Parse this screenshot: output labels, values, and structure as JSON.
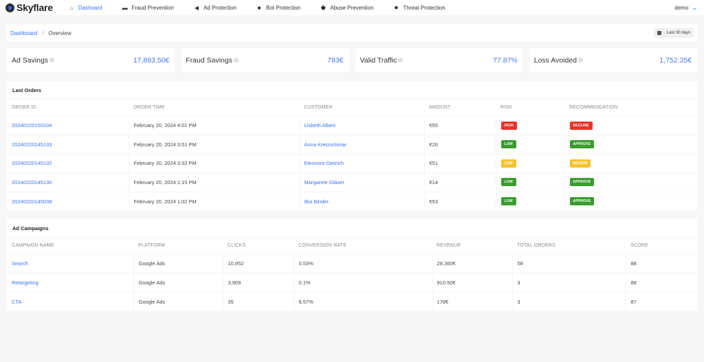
{
  "brand": {
    "name": "Skyflare"
  },
  "nav": {
    "items": [
      {
        "label": "Dashoard",
        "icon": "home-icon",
        "active": true
      },
      {
        "label": "Fraud Prevention",
        "icon": "credit-card-icon",
        "active": false
      },
      {
        "label": "Ad Protection",
        "icon": "megaphone-icon",
        "active": false
      },
      {
        "label": "Bot Protection",
        "icon": "robot-icon",
        "active": false
      },
      {
        "label": "Abuse Prevention",
        "icon": "shield-icon",
        "active": false
      },
      {
        "label": "Threat Protection",
        "icon": "gear-icon",
        "active": false
      }
    ],
    "user": "demo"
  },
  "breadcrumb": {
    "root": "Dashboard",
    "separator": "/",
    "current": "Overview"
  },
  "date_range": "Last 30 days",
  "stats": [
    {
      "label": "Ad Savings",
      "value": "17,893.50€"
    },
    {
      "label": "Fraud Savings",
      "value": "783€"
    },
    {
      "label": "Valid Traffic",
      "value": "77.87%"
    },
    {
      "label": "Loss Avoided",
      "value": "1,752.35€"
    }
  ],
  "orders": {
    "title": "Last Orders",
    "columns": [
      "ORDER ID",
      "ORDER TIME",
      "CUSTOMER",
      "AMOUNT",
      "RISK",
      "RECOMMENDATION"
    ],
    "rows": [
      {
        "id": "20240220150104",
        "time": "February 20, 2024 4:01 PM",
        "customer": "Lisbeth Albert",
        "amount": "€55",
        "risk": "HIGH",
        "risk_color": "red",
        "rec": "DECLINE",
        "rec_color": "red"
      },
      {
        "id": "20240220145133",
        "time": "February 20, 2024 3:51 PM",
        "customer": "Anna Kretzschmar",
        "amount": "€26",
        "risk": "LOW",
        "risk_color": "green",
        "rec": "APPROVE",
        "rec_color": "green"
      },
      {
        "id": "20240220145132",
        "time": "February 20, 2024 3:32 PM",
        "customer": "Eleonore Dietrich",
        "amount": "€51",
        "risk": "LOW",
        "risk_color": "yellow",
        "rec": "REVIEW",
        "rec_color": "yellow"
      },
      {
        "id": "20240220145130",
        "time": "February 20, 2024 1:15 PM",
        "customer": "Margarete Gläser",
        "amount": "€14",
        "risk": "LOW",
        "risk_color": "green",
        "rec": "APPROVE",
        "rec_color": "green"
      },
      {
        "id": "20240220145038",
        "time": "February 20, 2024 1:02 PM",
        "customer": "Ilka Binder",
        "amount": "€53",
        "risk": "LOW",
        "risk_color": "green",
        "rec": "APPROVE",
        "rec_color": "green"
      }
    ]
  },
  "campaigns": {
    "title": "Ad Campaigns",
    "columns": [
      "CAMPAIGN NAME",
      "PLATFORM",
      "CLICKS",
      "CONVERSION RATE",
      "REVENUE",
      "TOTAL ORDERS",
      "SCORE"
    ],
    "rows": [
      {
        "name": "Search",
        "platform": "Google Ads",
        "clicks": "10,952",
        "conversion": "0.53%",
        "revenue": "29,360€",
        "orders": "58",
        "score": "88"
      },
      {
        "name": "Retargeting",
        "platform": "Google Ads",
        "clicks": "3,909",
        "conversion": "0.1%",
        "revenue": "910.50€",
        "orders": "3",
        "score": "88"
      },
      {
        "name": "CTA",
        "platform": "Google Ads",
        "clicks": "35",
        "conversion": "8.57%",
        "revenue": "178€",
        "orders": "3",
        "score": "87"
      }
    ]
  },
  "colors": {
    "accent": "#3b6ff5",
    "danger": "#e63329",
    "success": "#3a9c2f",
    "warning": "#f4c430"
  }
}
